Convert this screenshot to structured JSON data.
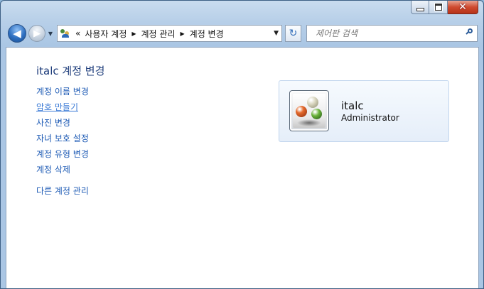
{
  "title_bar": {
    "minimize_label": "",
    "maximize_label": "",
    "close_label": "✕"
  },
  "nav": {
    "back_glyph": "◀",
    "forward_glyph": "▶",
    "recent_glyph": "▼",
    "refresh_glyph": "↻",
    "breadcrumb_overflow": "«",
    "breadcrumbs": [
      "사용자 계정",
      "계정 관리",
      "계정 변경"
    ],
    "search_placeholder": "제어판 검색"
  },
  "main": {
    "title": "italc 계정 변경",
    "tasks": [
      {
        "label": "계정 이름 변경",
        "hovered": false
      },
      {
        "label": "암호 만들기",
        "hovered": true
      },
      {
        "label": "사진 변경",
        "hovered": false
      },
      {
        "label": "자녀 보호 설정",
        "hovered": false
      },
      {
        "label": "계정 유형 변경",
        "hovered": false
      },
      {
        "label": "계정 삭제",
        "hovered": false
      }
    ],
    "manage_other": "다른 계정 관리"
  },
  "account": {
    "name": "italc",
    "type": "Administrator",
    "avatar": "marbles-picture"
  },
  "colors": {
    "link": "#1e5bb5",
    "title": "#1e3d7b",
    "close_button": "#cf4a2f"
  }
}
